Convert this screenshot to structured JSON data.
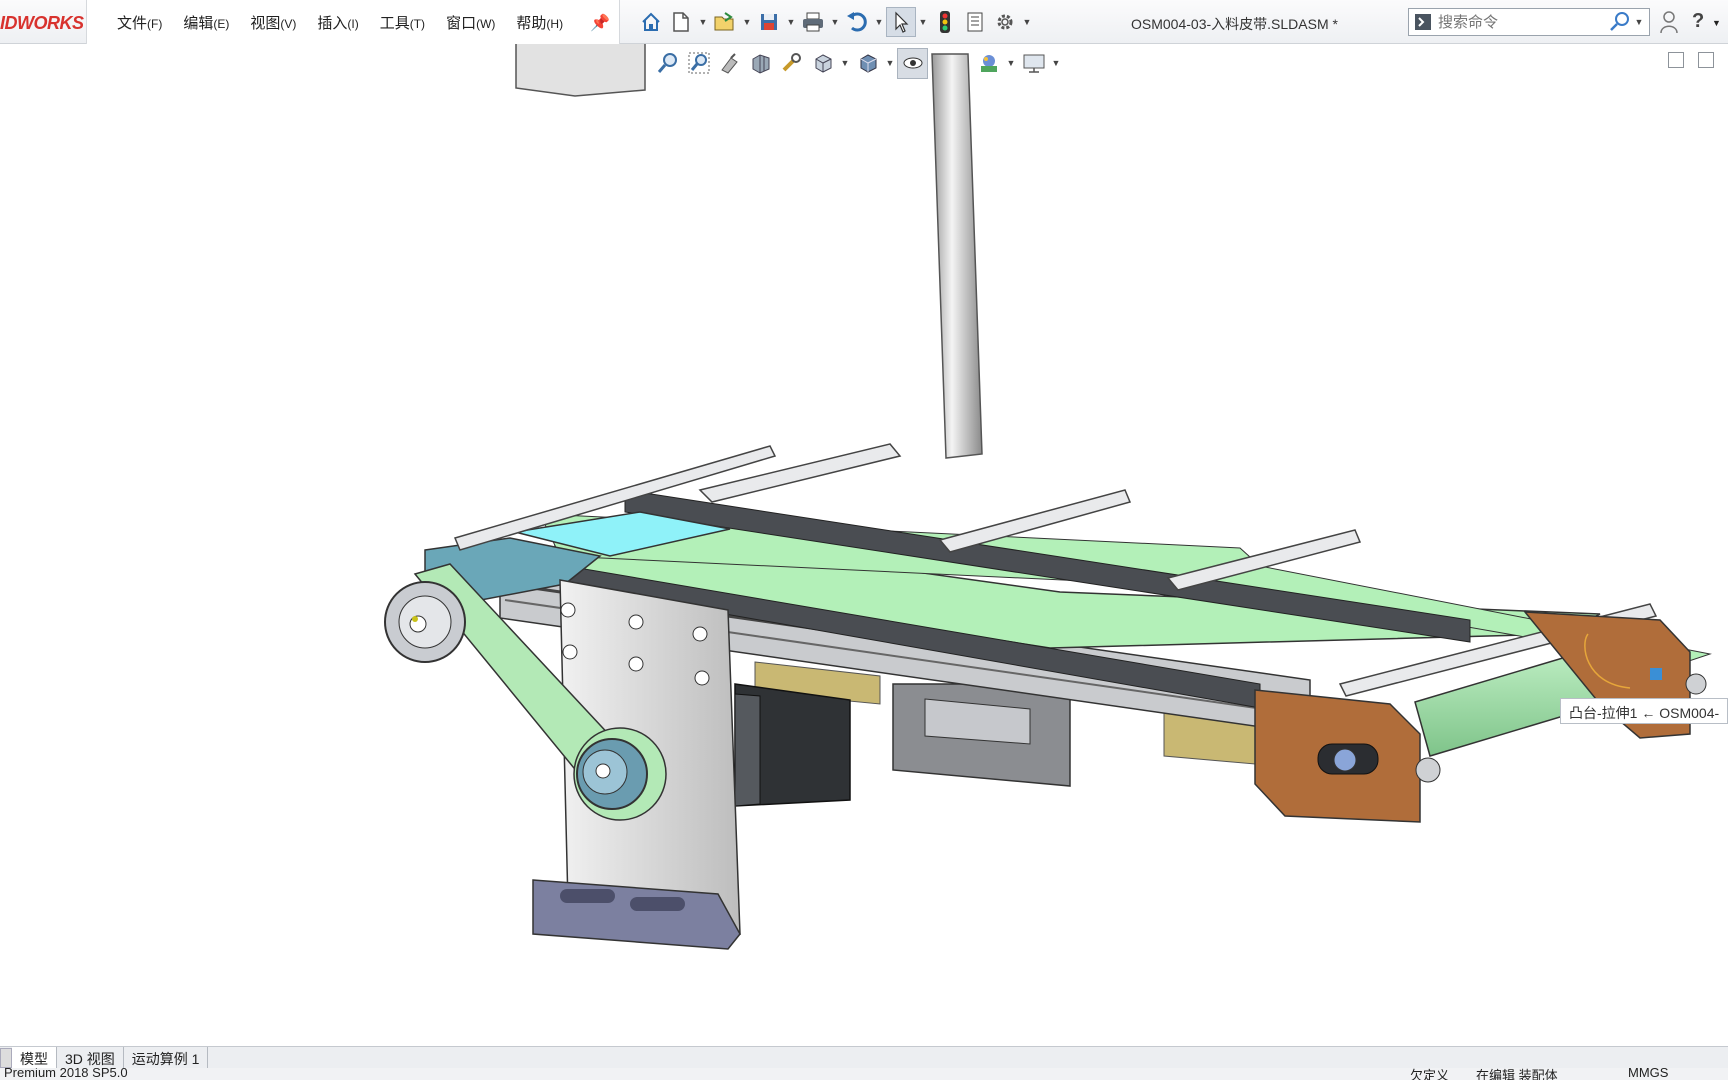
{
  "app": {
    "logo_text": "IDWORKS",
    "document_title": "OSM004-03-入料皮带.SLDASM *"
  },
  "menu": [
    {
      "label": "文件",
      "accel": "(F)"
    },
    {
      "label": "编辑",
      "accel": "(E)"
    },
    {
      "label": "视图",
      "accel": "(V)"
    },
    {
      "label": "插入",
      "accel": "(I)"
    },
    {
      "label": "工具",
      "accel": "(T)"
    },
    {
      "label": "窗口",
      "accel": "(W)"
    },
    {
      "label": "帮助",
      "accel": "(H)"
    }
  ],
  "quick_access": [
    "home-icon",
    "new-document-icon",
    "open-icon",
    "save-icon",
    "print-icon",
    "undo-icon",
    "select-icon",
    "rebuild-icon",
    "file-properties-icon",
    "options-icon"
  ],
  "heads_up": [
    "zoom-to-fit-icon",
    "zoom-to-area-icon",
    "previous-view-icon",
    "section-view-icon",
    "dynamic-annotation-icon",
    "view-orientation-icon",
    "display-style-icon",
    "hide-show-items-icon",
    "edit-appearance-icon",
    "apply-scene-icon",
    "view-settings-icon"
  ],
  "search": {
    "placeholder": "搜索命令"
  },
  "tooltip": {
    "text": "凸台-拉伸1 ← OSM004-"
  },
  "tabs": [
    {
      "label": "模型",
      "active": true
    },
    {
      "label": "3D 视图",
      "active": false
    },
    {
      "label": "运动算例 1",
      "active": false
    }
  ],
  "status": {
    "version": "Premium 2018 SP5.0",
    "definition": "欠定义",
    "editing": "在编辑 装配体",
    "units": "MMGS"
  },
  "colors": {
    "accent_red": "#d8322e",
    "belt_green": "#b3f0b8",
    "belt_dark": "#4a4d52",
    "cyan_part": "#8ff2f9",
    "bracket_copper": "#b06d3a",
    "pulley_teal": "#6aa7b8"
  }
}
